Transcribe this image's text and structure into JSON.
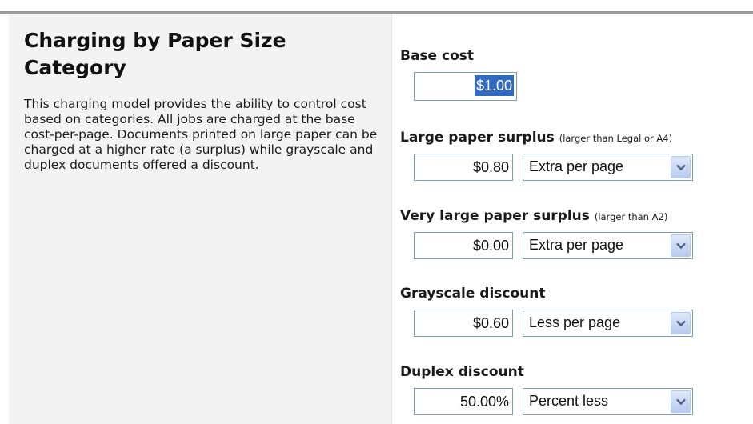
{
  "heading": {
    "title": "Charging by Paper Size Category",
    "description": "This charging model provides the ability to control cost based on categories. All jobs are charged at the base cost-per-page. Documents printed on large paper can be charged at a higher rate (a surplus) while grayscale and duplex documents offered a discount."
  },
  "fields": {
    "base_cost": {
      "label": "Base cost",
      "value": "$1.00"
    },
    "large_surplus": {
      "label": "Large paper surplus",
      "note": "(larger than Legal or A4)",
      "value": "$0.80",
      "mode": "Extra per page"
    },
    "very_large_surplus": {
      "label": "Very large paper surplus",
      "note": "(larger than A2)",
      "value": "$0.00",
      "mode": "Extra per page"
    },
    "grayscale_discount": {
      "label": "Grayscale discount",
      "value": "$0.60",
      "mode": "Less per page"
    },
    "duplex_discount": {
      "label": "Duplex discount",
      "value": "50.00%",
      "mode": "Percent less"
    }
  },
  "icons": {
    "dropdown": "chevron-down-icon"
  },
  "colors": {
    "selection": "#316ac5",
    "panel": "#f3f3f3",
    "input_border": "#7f9db9"
  }
}
